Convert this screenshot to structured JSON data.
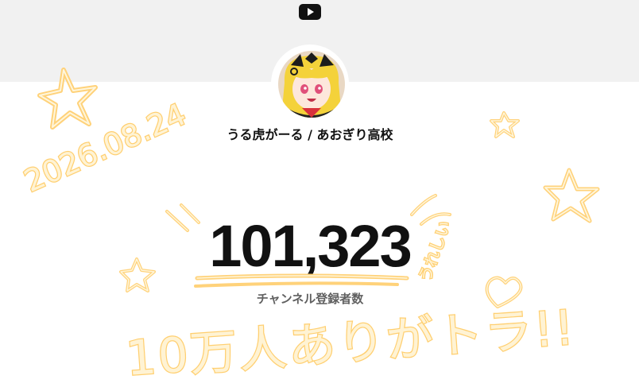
{
  "header": {
    "logo_icon": "youtube-play-icon",
    "background_color": "#f1f1f1"
  },
  "channel": {
    "avatar_icon": "avatar-tiger-girl",
    "name": "うる虎がーる / あおぎり高校"
  },
  "subscribers": {
    "count": "101,323",
    "label": "チャンネル登録者数"
  },
  "handwriting": {
    "date": "2026.08.24",
    "thanks": "10万人ありがトラ!!",
    "side_note": "うれしい",
    "accent_color": "#ffd27a"
  }
}
